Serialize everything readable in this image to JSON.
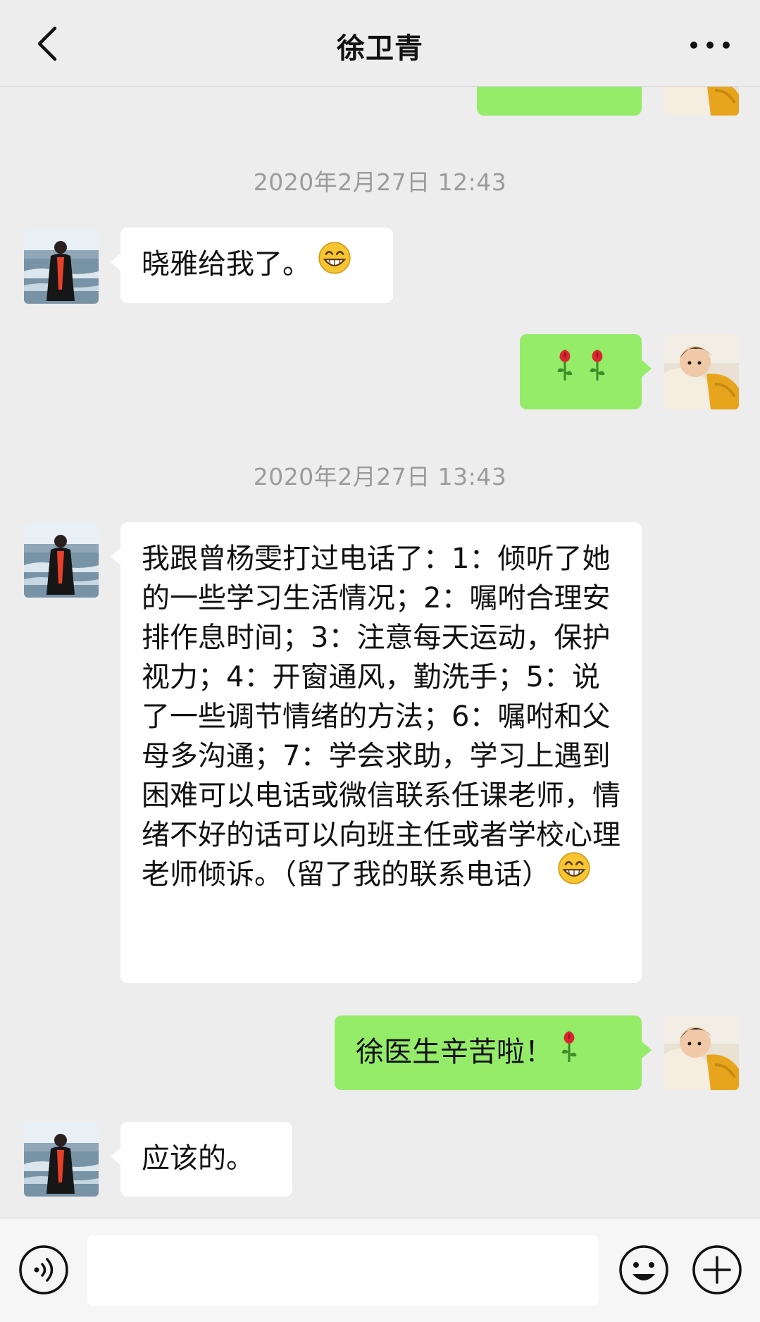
{
  "header": {
    "title": "徐卫青",
    "back_icon": "chevron-left-icon",
    "more_icon": "more-dots-icon"
  },
  "messages": [
    {
      "side": "right",
      "text": "",
      "partial": true
    },
    {
      "timestamp": "2020年2月27日 12:43"
    },
    {
      "side": "left",
      "text": "晓雅给我了。",
      "emoji": "grin-emoji"
    },
    {
      "side": "right",
      "emoji": "rose-emoji",
      "count": 2
    },
    {
      "timestamp": "2020年2月27日 13:43"
    },
    {
      "side": "left",
      "text": "我跟曾杨雯打过电话了：1：倾听了她的一些学习生活情况；2：嘱咐合理安排作息时间；3：注意每天运动，保护视力；4：开窗通风，勤洗手；5：说了一些调节情绪的方法；6：嘱咐和父母多沟通；7：学会求助，学习上遇到困难可以电话或微信联系任课老师，情绪不好的话可以向班主任或者学校心理老师倾诉。（留了我的联系电话）",
      "emoji": "grin-emoji"
    },
    {
      "side": "right",
      "text": "徐医生辛苦啦！",
      "emoji": "rose-emoji"
    },
    {
      "side": "left",
      "text": "应该的。"
    }
  ],
  "ts1": "2020年2月27日 12:43",
  "ts2": "2020年2月27日 13:43",
  "msg_left_1": "晓雅给我了。",
  "msg_left_2": "我跟曾杨雯打过电话了：1：倾听了她的一些学习生活情况；2：嘱咐合理安排作息时间；3：注意每天运动，保护视力；4：开窗通风，勤洗手；5：说了一些调节情绪的方法；6：嘱咐和父母多沟通；7：学会求助，学习上遇到困难可以电话或微信联系任课老师，情绪不好的话可以向班主任或者学校心理老师倾诉。（留了我的联系电话）",
  "msg_right_2": "徐医生辛苦啦！",
  "msg_left_3": "应该的。",
  "input": {
    "value": "",
    "voice_icon": "voice-icon",
    "emoji_icon": "emoji-icon",
    "plus_icon": "plus-icon"
  },
  "colors": {
    "background": "#ededed",
    "bubble_self": "#95ec69",
    "bubble_other": "#ffffff",
    "timestamp": "#9b9b9b"
  }
}
